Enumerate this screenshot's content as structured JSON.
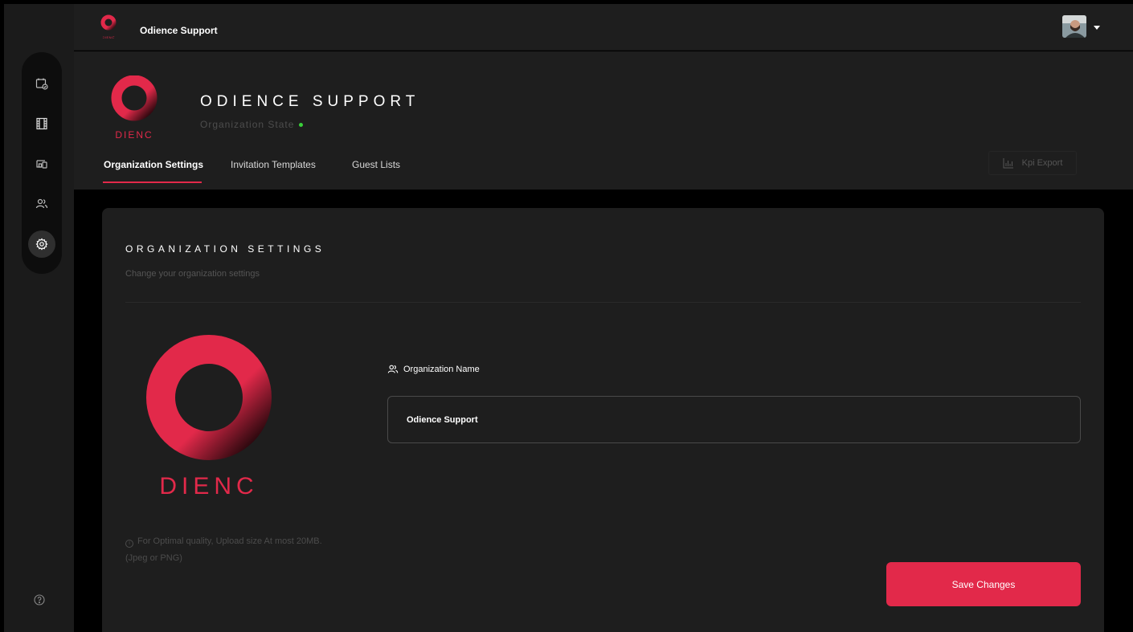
{
  "topbar": {
    "title": "Odience Support"
  },
  "sidebar": {
    "items": [
      {
        "icon": "calendar-check-icon"
      },
      {
        "icon": "film-strip-icon"
      },
      {
        "icon": "devices-icon"
      },
      {
        "icon": "users-icon"
      },
      {
        "icon": "settings-gear-icon",
        "active": true
      }
    ],
    "help_icon": "help-circle-icon"
  },
  "org": {
    "name": "ODIENCE SUPPORT",
    "state_label": "Organization State",
    "state_color": "#3ad13a",
    "logo_text": "DIENC"
  },
  "tabs": [
    {
      "label": "Organization Settings",
      "active": true
    },
    {
      "label": "Invitation Templates",
      "active": false
    },
    {
      "label": "Guest Lists",
      "active": false
    }
  ],
  "kpi_export": {
    "label": "Kpi Export",
    "icon": "bar-chart-icon"
  },
  "settings": {
    "title": "ORGANIZATION SETTINGS",
    "subtitle": "Change your organization settings",
    "upload_hint": "For Optimal quality, Upload size At most 20MB. (Jpeg or PNG)",
    "name_label": "Organization Name",
    "name_value": "Odience Support",
    "save_label": "Save Changes"
  },
  "colors": {
    "accent": "#e2294a",
    "background": "#000000",
    "panel": "#1e1e1e"
  }
}
